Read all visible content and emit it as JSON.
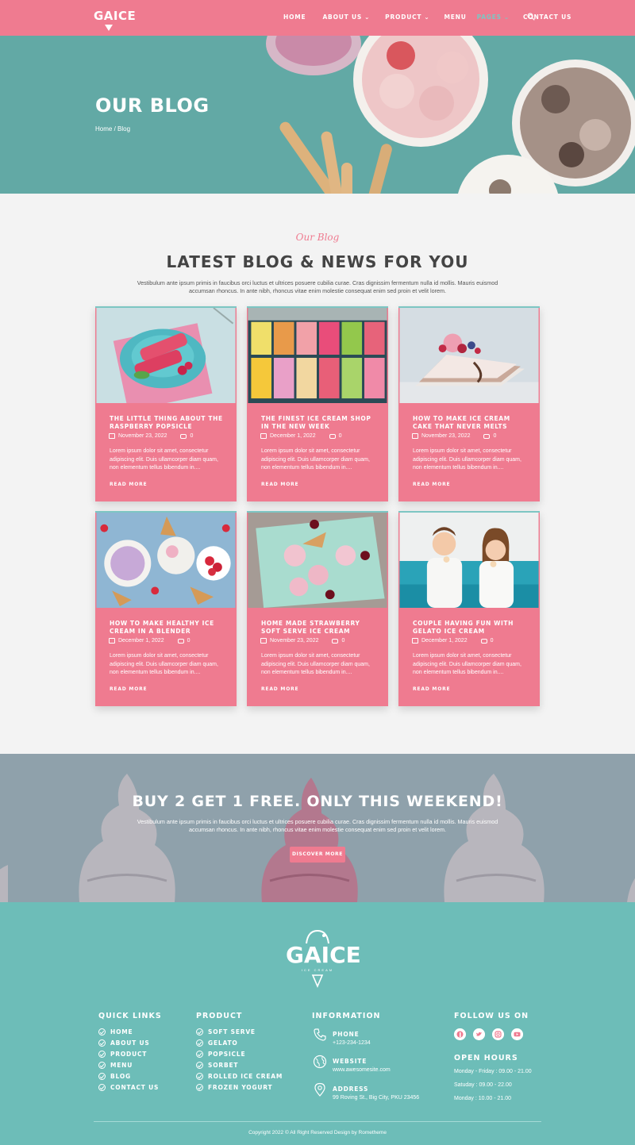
{
  "brand": {
    "logo_text": "GAICE"
  },
  "nav": {
    "items": [
      {
        "label": "HOME"
      },
      {
        "label": "ABOUT US"
      },
      {
        "label": "PRODUCT"
      },
      {
        "label": "MENU"
      },
      {
        "label": "PAGES"
      },
      {
        "label": "CONTACT US"
      }
    ]
  },
  "hero": {
    "title": "OUR BLOG",
    "breadcrumb": "Home / Blog"
  },
  "section": {
    "script_title": "Our Blog",
    "title": "LATEST BLOG & NEWS FOR YOU",
    "description": "Vestibulum ante ipsum primis in faucibus orci luctus et ultrices posuere cubilia curae. Cras dignissim fermentum nulla id mollis. Mauris euismod accumsan rhoncus. In ante nibh, rhoncus vitae enim molestie consequat enim sed proin et velit lorem."
  },
  "posts": [
    {
      "title": "THE LITTLE THING ABOUT THE RASPBERRY POPSICLE",
      "date": "November 23, 2022",
      "comments": "0",
      "excerpt": "Lorem ipsum dolor sit amet, consectetur adipiscing elit. Duis ullamcorper diam quam, non elementum tellus bibendum in....",
      "more": "READ MORE"
    },
    {
      "title": "THE FINEST ICE CREAM SHOP IN THE NEW WEEK",
      "date": "December 1, 2022",
      "comments": "0",
      "excerpt": "Lorem ipsum dolor sit amet, consectetur adipiscing elit. Duis ullamcorper diam quam, non elementum tellus bibendum in....",
      "more": "READ MORE"
    },
    {
      "title": "HOW TO MAKE ICE CREAM CAKE THAT NEVER MELTS",
      "date": "November 23, 2022",
      "comments": "0",
      "excerpt": "Lorem ipsum dolor sit amet, consectetur adipiscing elit. Duis ullamcorper diam quam, non elementum tellus bibendum in....",
      "more": "READ MORE"
    },
    {
      "title": "HOW TO MAKE HEALTHY ICE CREAM IN A BLENDER",
      "date": "December 1, 2022",
      "comments": "0",
      "excerpt": "Lorem ipsum dolor sit amet, consectetur adipiscing elit. Duis ullamcorper diam quam, non elementum tellus bibendum in....",
      "more": "READ MORE"
    },
    {
      "title": "HOME MADE STRAWBERRY SOFT SERVE ICE CREAM",
      "date": "November 23, 2022",
      "comments": "0",
      "excerpt": "Lorem ipsum dolor sit amet, consectetur adipiscing elit. Duis ullamcorper diam quam, non elementum tellus bibendum in....",
      "more": "READ MORE"
    },
    {
      "title": "COUPLE HAVING FUN WITH GELATO ICE CREAM",
      "date": "December 1, 2022",
      "comments": "0",
      "excerpt": "Lorem ipsum dolor sit amet, consectetur adipiscing elit. Duis ullamcorper diam quam, non elementum tellus bibendum in....",
      "more": "READ MORE"
    }
  ],
  "promo": {
    "title": "BUY 2 GET 1 FREE. ONLY THIS WEEKEND!",
    "description": "Vestibulum ante ipsum primis in faucibus orci luctus et ultrices posuere cubilia curae. Cras dignissim fermentum nulla id mollis. Mauris euismod accumsan rhoncus. In ante nibh, rhoncus vitae enim molestie consequat enim sed proin et velit lorem.",
    "button": "DISCOVER MORE"
  },
  "footer": {
    "logo_text": "GAICE",
    "logo_sub": "ICE CREAM",
    "quick_links": {
      "heading": "QUICK LINKS",
      "items": [
        "HOME",
        "ABOUT US",
        "PRODUCT",
        "MENU",
        "BLOG",
        "CONTACT US"
      ]
    },
    "product": {
      "heading": "PRODUCT",
      "items": [
        "SOFT SERVE",
        "GELATO",
        "POPSICLE",
        "SORBET",
        "ROLLED ICE CREAM",
        "FROZEN YOGURT"
      ]
    },
    "information": {
      "heading": "INFORMATION",
      "phone_label": "PHONE",
      "phone": "+123-234-1234",
      "website_label": "WEBSITE",
      "website": "www.awesomesite.com",
      "address_label": "ADDRESS",
      "address": "99 Roving St., Big City, PKU 23456"
    },
    "follow": {
      "heading": "FOLLOW US ON",
      "icons": [
        "facebook-icon",
        "twitter-icon",
        "instagram-icon",
        "youtube-icon"
      ]
    },
    "hours": {
      "heading": "OPEN HOURS",
      "lines": [
        "Monday - Friday : 09.00 - 21.00",
        "Satuday : 09.00 - 22.00",
        "Monday : 10.00 - 21.00"
      ]
    },
    "copyright": "Copyright 2022 © All Right Reserved Design by Rometheme"
  },
  "colors": {
    "primary": "#ef7b90",
    "teal": "#6dbdb8",
    "accent": "#7dc6c3"
  }
}
